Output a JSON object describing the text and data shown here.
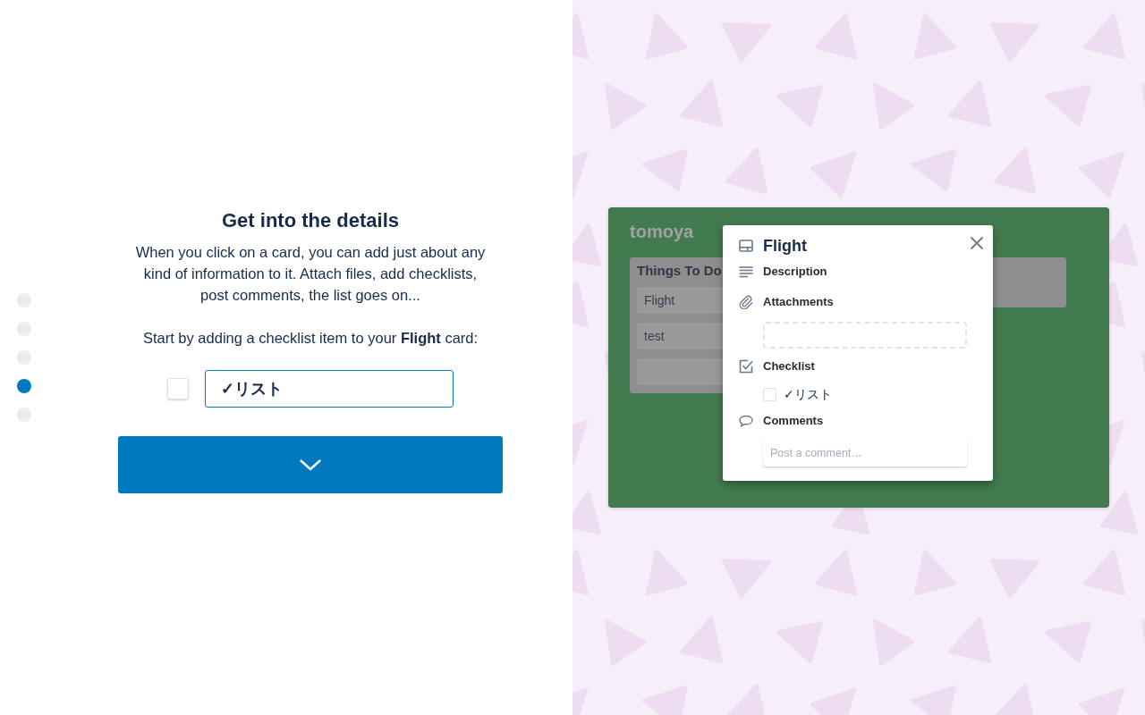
{
  "progress_steps": [
    {
      "selected": false
    },
    {
      "selected": false
    },
    {
      "selected": false
    },
    {
      "selected": true
    },
    {
      "selected": false
    }
  ],
  "step": {
    "title": "Get into the details",
    "description": "When you click on a card, you can add just about any kind of information to it. Attach files, add checklists, post comments, the list goes on...",
    "prompt": "Start by adding a checklist item to your **Flight** card:",
    "entry": {
      "checked": false,
      "value": "✓リスト"
    }
  },
  "board": {
    "title": "tomoya",
    "lists": [
      {
        "title": "Things To Do",
        "cards": [
          {
            "kind": "text",
            "text": "Flight"
          },
          {
            "kind": "text",
            "text": "test"
          },
          {
            "kind": "blank"
          }
        ]
      }
    ]
  },
  "card_popup": {
    "title": "Flight",
    "sections": [
      {
        "kind": "description",
        "label": "Description"
      },
      {
        "kind": "attachments",
        "label": "Attachments"
      },
      {
        "kind": "checklist",
        "label": "Checklist",
        "items": [
          {
            "text": "✓リスト",
            "checked": false
          }
        ]
      },
      {
        "kind": "comments",
        "label": "Comments",
        "placeholder": "Post a comment…"
      }
    ]
  }
}
